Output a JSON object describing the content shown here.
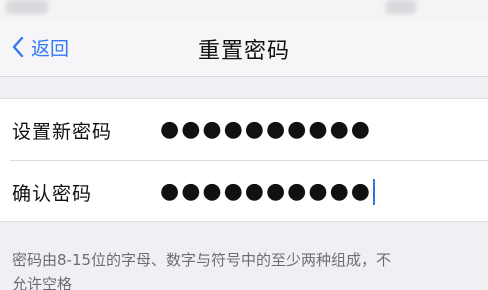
{
  "nav": {
    "back_label": "返回",
    "title": "重置密码"
  },
  "form": {
    "new_password": {
      "label": "设置新密码",
      "masked_value": "●●●●●●●●●●"
    },
    "confirm_password": {
      "label": "确认密码",
      "masked_value": "●●●●●●●●●●"
    }
  },
  "footer": {
    "line1": "密码由8-15位的字母、数字与符号中的至少两种组成，不",
    "line2": "允许空格"
  },
  "colors": {
    "accent": "#3478f6",
    "caret": "#2f6fe8",
    "background": "#efeff4"
  },
  "icons": {
    "back": "chevron-left-icon"
  }
}
